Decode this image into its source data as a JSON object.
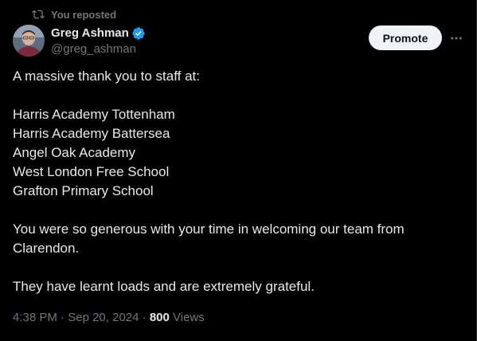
{
  "repost": {
    "label": "You reposted"
  },
  "author": {
    "name": "Greg Ashman",
    "handle": "@greg_ashman",
    "verified_color": "#1d9bf0"
  },
  "actions": {
    "promote_label": "Promote"
  },
  "tweet": {
    "intro": "A massive thank you to staff at:",
    "schools": [
      "Harris Academy Tottenham",
      "Harris Academy Battersea",
      "Angel Oak Academy",
      "West London Free School",
      "Grafton Primary School"
    ],
    "para2_line1": "You were so generous with your time in welcoming our team from",
    "para2_line2": "Clarendon.",
    "para3": "They have learnt loads and are extremely grateful."
  },
  "meta": {
    "time": "4:38 PM",
    "separator1": " · ",
    "date": "Sep 20, 2024",
    "separator2": " · ",
    "views_count": "800",
    "views_label": " Views"
  },
  "icons": {
    "repost": "repost-icon",
    "verified": "verified-badge-icon",
    "more": "more-icon"
  }
}
